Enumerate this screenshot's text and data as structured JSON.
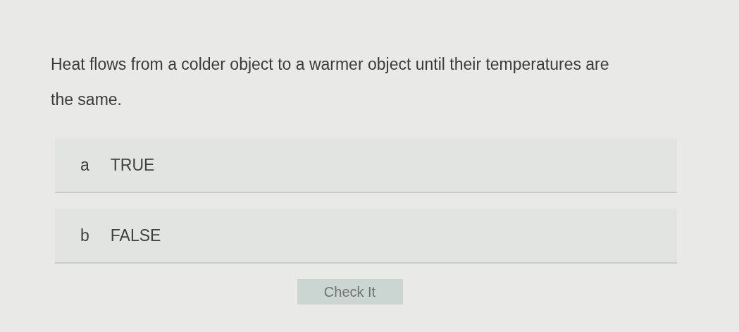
{
  "question": "Heat flows from a colder object to a warmer object until their temperatures are the same.",
  "options": [
    {
      "letter": "a",
      "label": "TRUE",
      "selected": false
    },
    {
      "letter": "b",
      "label": "FALSE",
      "selected": false
    }
  ],
  "button": "Check It"
}
